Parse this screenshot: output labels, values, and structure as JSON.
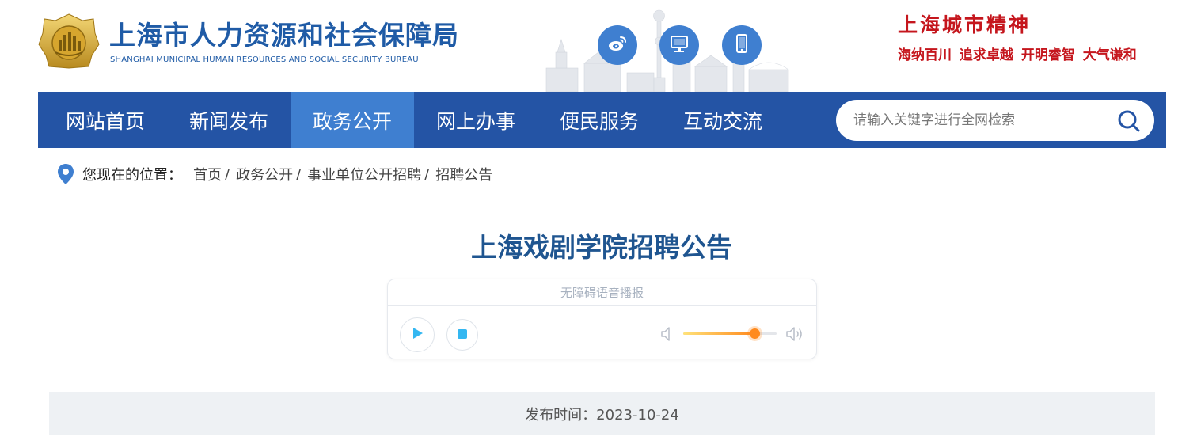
{
  "header": {
    "title": "上海市人力资源和社会保障局",
    "subtitle": "SHANGHAI MUNICIPAL HUMAN RESOURCES AND SOCIAL SECURITY BUREAU",
    "social": [
      {
        "icon": "weibo-icon"
      },
      {
        "icon": "desktop-icon"
      },
      {
        "icon": "mobile-icon"
      }
    ],
    "spirit_title": "上海城市精神",
    "spirit_values": "海纳百川 追求卓越 开明睿智 大气谦和"
  },
  "nav": {
    "items": [
      {
        "label": "网站首页"
      },
      {
        "label": "新闻发布"
      },
      {
        "label": "政务公开"
      },
      {
        "label": "网上办事"
      },
      {
        "label": "便民服务"
      },
      {
        "label": "互动交流"
      }
    ],
    "active_index": 2,
    "search_placeholder": "请输入关键字进行全网检索"
  },
  "breadcrumb": {
    "label": "您现在的位置：",
    "items": [
      "首页",
      "政务公开",
      "事业单位公开招聘",
      "招聘公告"
    ]
  },
  "article": {
    "title": "上海戏剧学院招聘公告",
    "player_title": "无障碍语音播报",
    "volume": 0.76,
    "publish": "发布时间：2023-10-24"
  },
  "colors": {
    "brand_blue": "#2454a5",
    "active_blue": "#3f7fd0",
    "spirit_red": "#c5161d",
    "title_blue": "#1f5590"
  }
}
